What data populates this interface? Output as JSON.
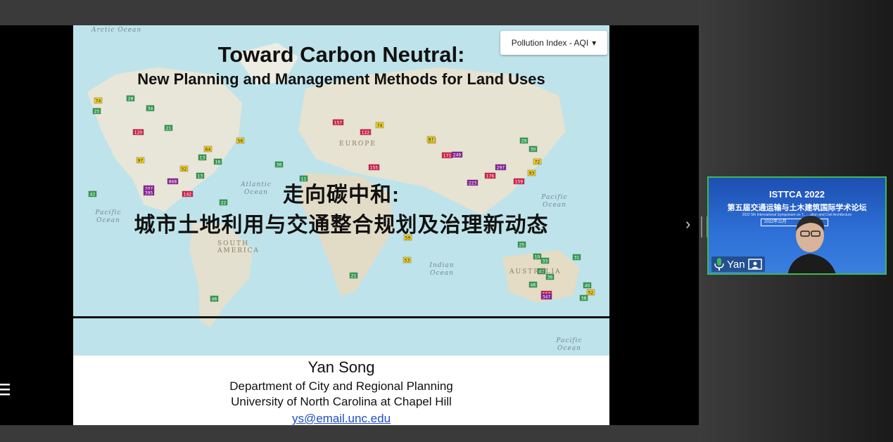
{
  "slide": {
    "title_en_line1": "Toward Carbon Neutral:",
    "title_en_line2": "New Planning and Management Methods for Land Uses",
    "title_zh_line1": "走向碳中和:",
    "title_zh_line2": "城市土地利用与交通整合规划及治理新动态",
    "author": "Yan Song",
    "department": "Department of City and Regional Planning",
    "university": "University of North Carolina at Chapel Hill",
    "email": "ys@email.unc.edu",
    "map": {
      "dropdown_label": "Pollution Index - AQI",
      "dropdown_icon": "caret-down-icon",
      "ocean_labels": [
        "Arctic Ocean",
        "Atlantic Ocean",
        "Pacific Ocean",
        "Pacific Ocean",
        "Indian Ocean",
        "Pacific Ocean"
      ],
      "continent_labels": [
        "EUROPE",
        "SOUTH AMERICA",
        "AUSTRALIA"
      ],
      "aqi_markers": [
        "74",
        "28",
        "25",
        "34",
        "21",
        "120",
        "97",
        "207",
        "395",
        "868",
        "142",
        "13",
        "22",
        "36",
        "42",
        "11",
        "52",
        "64",
        "157",
        "122",
        "59",
        "21",
        "46",
        "56",
        "13",
        "16",
        "97",
        "155",
        "171",
        "249",
        "176",
        "223",
        "297",
        "159",
        "29",
        "93",
        "72",
        "30",
        "53",
        "25",
        "10",
        "33",
        "47",
        "36",
        "46",
        "157",
        "347",
        "40",
        "52",
        "38",
        "31",
        "87",
        "74"
      ]
    }
  },
  "participant": {
    "name": "Yan",
    "banner_title": "ISTTCA 2022",
    "banner_subtitle": "第五届交通运输与土木建筑国际学术论坛",
    "banner_caption": "2022 5th International Symposium on T... ...ation and Civil Architecture",
    "banner_date": "2022年11月",
    "mic_icon": "microphone-icon",
    "screen_icon": "screen-share-icon"
  },
  "colors": {
    "tile_border": "#3fb950",
    "aqi_good": "#2e9e4f",
    "aqi_moderate": "#f0d020",
    "aqi_unhealthy": "#d6204e",
    "aqi_very_unhealthy": "#8a1f9a",
    "link": "#1f4fc4"
  }
}
